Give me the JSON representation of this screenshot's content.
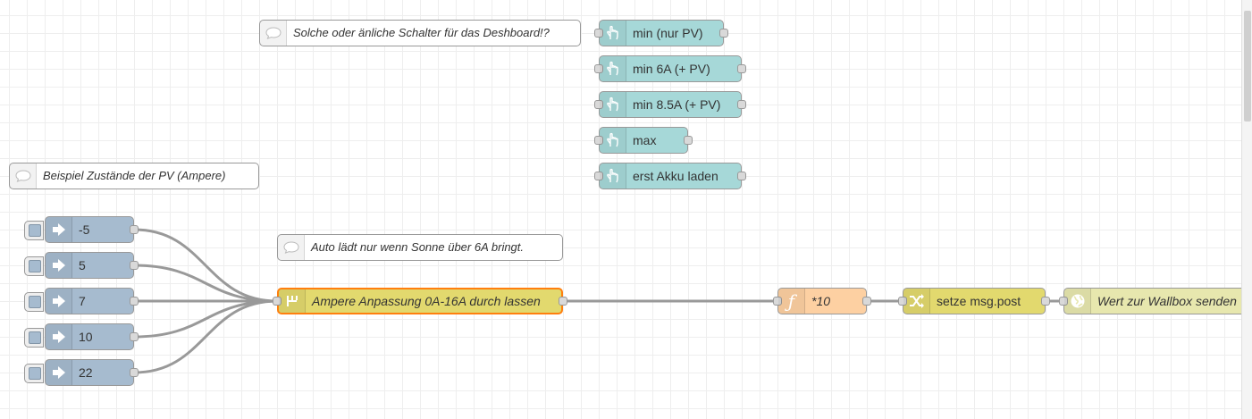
{
  "comments": {
    "dashboard_switches": "Solche oder änliche Schalter für das Deshboard!?",
    "pv_states": "Beispiel Zustände der PV (Ampere)",
    "auto_charge": "Auto lädt nur wenn Sonne über 6A bringt."
  },
  "dashboard_buttons": [
    "min (nur PV)",
    "min 6A (+ PV)",
    "min 8.5A (+ PV)",
    "max",
    "erst Akku laden"
  ],
  "inject_nodes": [
    "-5",
    "5",
    "7",
    "10",
    "22"
  ],
  "switch_node": {
    "label": "Ampere Anpassung 0A-16A durch lassen"
  },
  "function_node": {
    "label": "*10"
  },
  "change_node": {
    "label": "setze msg.post"
  },
  "http_node": {
    "label": "Wert zur Wallbox senden"
  },
  "icons": {
    "comment": "comment-icon",
    "button": "hand-pointer-icon",
    "inject": "arrow-right-icon",
    "switch": "switch-icon",
    "function": "function-icon",
    "change": "shuffle-icon",
    "http": "globe-icon"
  },
  "colors": {
    "dashboard": "#a6d8d8",
    "inject": "#a6bbcf",
    "switch": "#e2d96e",
    "function": "#fdd0a2",
    "change": "#e2d96e",
    "http": "#e7e7ae",
    "selected_border": "#ff7f0e",
    "wire": "#999999"
  }
}
